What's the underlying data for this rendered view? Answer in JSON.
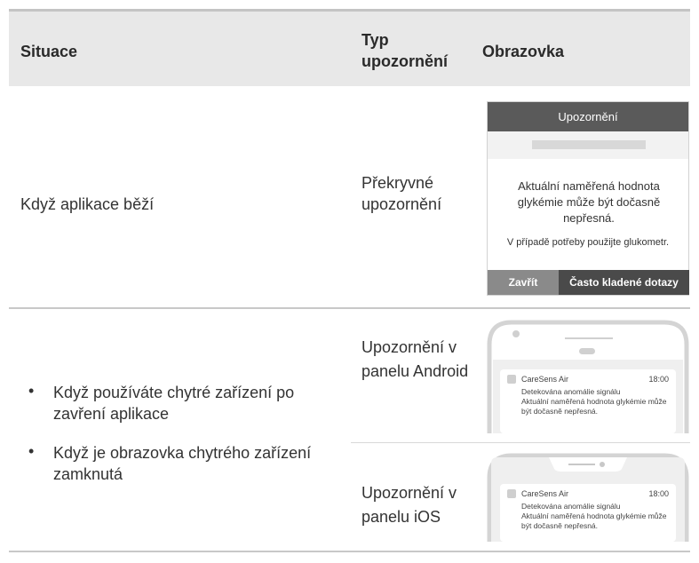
{
  "header": {
    "col1": "Situace",
    "col2": "Typ upozornění",
    "col3": "Obrazovka"
  },
  "row1": {
    "situation": "Když aplikace běží",
    "type": "Překryvné upozornění",
    "popup": {
      "title": "Upozornění",
      "message": "Aktuální naměřená hodnota glykémie může být dočasně nepřesná.",
      "note": "V případě potřeby použijte glukometr.",
      "close_label": "Zavřít",
      "faq_label": "Často kladené dotazy"
    }
  },
  "row2": {
    "bullets": [
      "Když používáte chytré zařízení po zavření aplikace",
      "Když je obrazovka chytrého zařízení zamknutá"
    ],
    "android": {
      "type": "Upozornění v panelu Android",
      "app_name": "CareSens Air",
      "time": "18:00",
      "line1": "Detekována anomálie signálu",
      "line2": "Aktuální naměřená hodnota glykémie může být dočasně nepřesná."
    },
    "ios": {
      "type": "Upozornění v panelu iOS",
      "app_name": "CareSens Air",
      "time": "18:00",
      "line1": "Detekována anomálie signálu",
      "line2": "Aktuální naměřená hodnota glykémie může být dočasně nepřesná."
    }
  },
  "colors": {
    "header_bg": "#e8e8e8",
    "popup_title_bg": "#5a5a5a",
    "close_btn_bg": "#8a8a8a",
    "faq_btn_bg": "#4a4a4a",
    "phone_frame": "#d4d4d4"
  }
}
